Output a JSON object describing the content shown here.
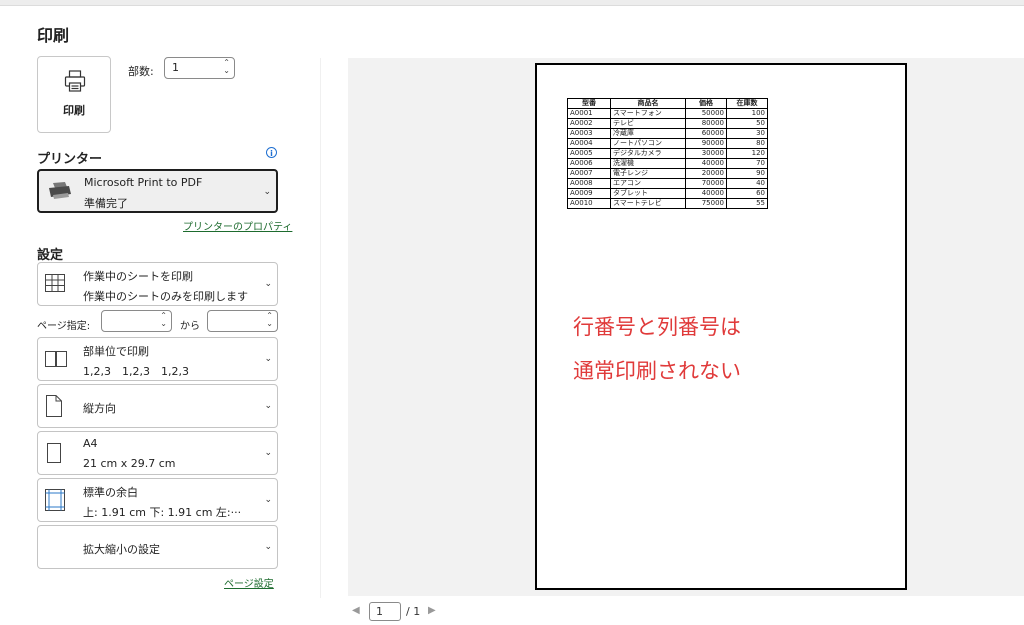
{
  "title": "印刷",
  "print_button": {
    "label": "印刷",
    "icon": "printer-icon"
  },
  "copies": {
    "label": "部数:",
    "value": "1"
  },
  "printer": {
    "section_label": "プリンター",
    "name": "Microsoft Print to PDF",
    "status": "準備完了",
    "properties_link": "プリンターのプロパティ"
  },
  "settings": {
    "section_label": "設定",
    "print_what": {
      "line1": "作業中のシートを印刷",
      "line2": "作業中のシートのみを印刷します"
    },
    "pages": {
      "label": "ページ指定:",
      "from_value": "",
      "to_label": "から",
      "to_value": ""
    },
    "collate": {
      "line1": "部単位で印刷",
      "line2": "1,2,3　1,2,3　1,2,3"
    },
    "orientation": {
      "line1": "縦方向"
    },
    "paper": {
      "line1": "A4",
      "line2": "21 cm x 29.7 cm"
    },
    "margins": {
      "line1": "標準の余白",
      "line2": "上: 1.91 cm 下: 1.91 cm 左:···"
    },
    "scaling": {
      "line1": "拡大縮小の設定"
    },
    "page_setup_link": "ページ設定"
  },
  "preview": {
    "headers": [
      "型番",
      "商品名",
      "価格",
      "在庫数"
    ],
    "rows": [
      [
        "A0001",
        "スマートフォン",
        "50000",
        "100"
      ],
      [
        "A0002",
        "テレビ",
        "80000",
        "50"
      ],
      [
        "A0003",
        "冷蔵庫",
        "60000",
        "30"
      ],
      [
        "A0004",
        "ノートパソコン",
        "90000",
        "80"
      ],
      [
        "A0005",
        "デジタルカメラ",
        "30000",
        "120"
      ],
      [
        "A0006",
        "洗濯機",
        "40000",
        "70"
      ],
      [
        "A0007",
        "電子レンジ",
        "20000",
        "90"
      ],
      [
        "A0008",
        "エアコン",
        "70000",
        "40"
      ],
      [
        "A0009",
        "タブレット",
        "40000",
        "60"
      ],
      [
        "A0010",
        "スマートテレビ",
        "75000",
        "55"
      ]
    ],
    "note_line1": "行番号と列番号は",
    "note_line2": "通常印刷されない"
  },
  "pager": {
    "current": "1",
    "total": "/ 1"
  },
  "colors": {
    "note_red": "#e03a3a",
    "link_green": "#1d6b2e",
    "info_blue": "#1f6fd1"
  }
}
